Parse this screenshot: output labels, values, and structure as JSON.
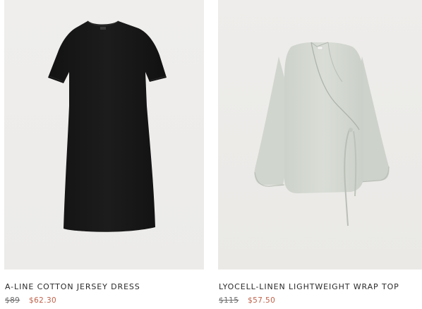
{
  "products": [
    {
      "name": "A-LINE COTTON JERSEY DRESS",
      "original_price": "$89",
      "sale_price": "$62.30",
      "image_icon": "black-t-shirt-dress-icon"
    },
    {
      "name": "LYOCELL-LINEN LIGHTWEIGHT WRAP TOP",
      "original_price": "$115",
      "sale_price": "$57.50",
      "image_icon": "sage-wrap-top-icon"
    }
  ],
  "colors": {
    "sale_price": "#c0614a",
    "old_price": "#6b6b6b",
    "dress": "#161616",
    "wrap_top": "#d4d8d1"
  }
}
